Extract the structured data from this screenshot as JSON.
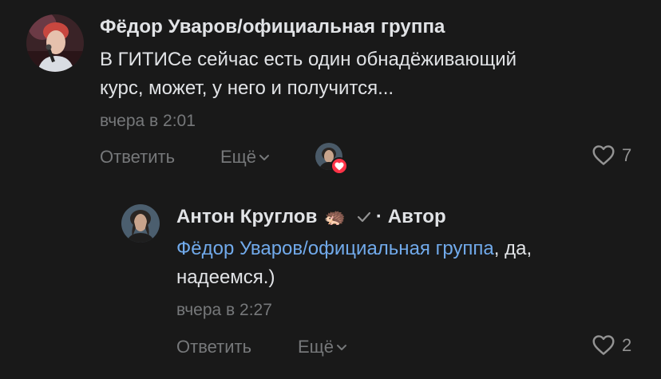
{
  "comment": {
    "author": "Фёдор Уваров/официальная группа",
    "text_line1": "В ГИТИСе сейчас есть один обнадёживающий",
    "text_line2": "курс, может, у него и получится...",
    "time": "вчера в 2:01",
    "reply_label": "Ответить",
    "more_label": "Ещё",
    "likes": "7"
  },
  "reply": {
    "author": "Антон Круглов",
    "author_emoji": "🦔",
    "author_tag": "· Автор",
    "mention": "Фёдор Уваров/официальная группа",
    "text_after_mention": ", да,",
    "text_line2": "надеемся.)",
    "time": "вчера в 2:27",
    "reply_label": "Ответить",
    "more_label": "Ещё",
    "likes": "2"
  },
  "colors": {
    "background": "#191919",
    "primary_text": "#e1e3e6",
    "secondary_text": "#76787a",
    "link": "#71aaeb",
    "heart_badge": "#ff3347"
  }
}
